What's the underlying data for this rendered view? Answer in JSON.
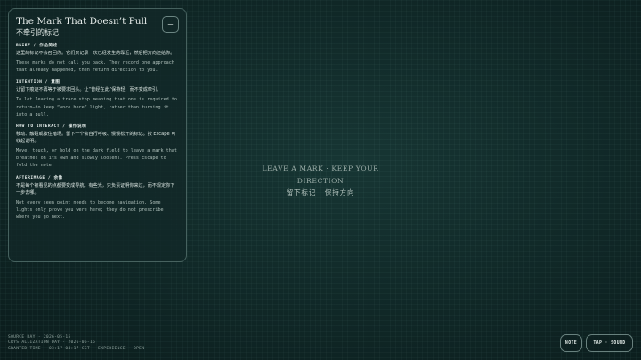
{
  "note": {
    "title": "The Mark That Doesn’t Pull",
    "subtitle": "不牵引的标记",
    "fold_label": "–",
    "sections": [
      {
        "label": "BRIEF / 作品简述",
        "zh": "这里的标记不会召回你。它们只记录一次已经发生的靠近，然后把方向还给你。",
        "en": "These marks do not call you back. They record one approach that already happened, then return direction to you."
      },
      {
        "label": "INTENTION / 意图",
        "zh": "让留下痕迹不再等于被要求回头。让“曾经在此”保持轻，而不变成牵引。",
        "en": "To let leaving a trace stop meaning that one is required to return—to keep “once here” light, rather than turning it into a pull."
      },
      {
        "label": "HOW TO INTERACT / 操作说明",
        "zh": "移动、触碰或按住暗场。留下一个会自行呼吸、慢慢松开的标记。按 Escape 可收起说明。",
        "en": "Move, touch, or hold on the dark field to leave a mark that breathes on its own and slowly loosens. Press Escape to fold the note."
      },
      {
        "label": "AFTERIMAGE / 余像",
        "zh": "不是每个被看见的点都要变成导航。有些光，只负责证明你来过，而不规定你下一步去哪。",
        "en": "Not every seen point needs to become navigation. Some lights only prove you were here; they do not prescribe where you go next."
      }
    ]
  },
  "center": {
    "en_line1": "LEAVE A MARK · KEEP YOUR",
    "en_line2": "DIRECTION",
    "zh": "留下标记 · 保持方向"
  },
  "footer": {
    "line1": "SOURCE DAY · 2026-05-15",
    "line2": "CRYSTALLIZATION DAY · 2026-05-16",
    "line3": "GRANTED TIME · 03:17—04:17 CST · EXPERIENCE · OPEN"
  },
  "controls": {
    "note_label": "NOTE",
    "tap_label": "TAP · SOUND"
  }
}
